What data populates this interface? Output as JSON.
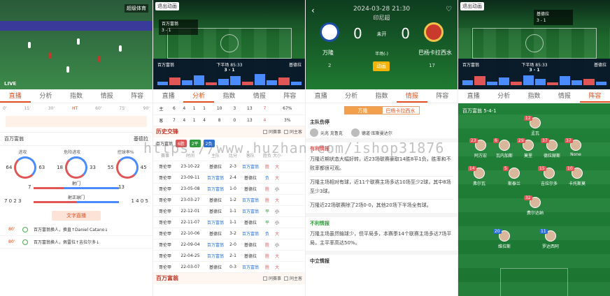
{
  "p1": {
    "video_channel": "超级体育",
    "live_label": "LIVE",
    "tabs": [
      "直播",
      "分析",
      "指数",
      "情报",
      "阵容"
    ],
    "timeline_marks": [
      "0'",
      "15'",
      "30'",
      "HT",
      "60'",
      "75'",
      "90'"
    ],
    "team_name": "百万富翁",
    "team_right": "基德拉",
    "stat_labels": [
      "进攻",
      "危险进攻",
      "控球率%"
    ],
    "stat_values": [
      "64",
      "63",
      "18",
      "33",
      "55",
      "45"
    ],
    "shots_label": "射门",
    "shots_left": "7",
    "shots_right": "13",
    "ontarget_label": "射正球门",
    "ontarget_left": "7 0 2 3",
    "ontarget_right": "1 4 0 5",
    "text_live_btn": "文字直播",
    "events": [
      {
        "minute": "80'",
        "text": "百万富翁换人，换直↑Daniel Catano↓"
      },
      {
        "minute": "80'",
        "text": "百万富翁换人，佩雷拉↑吉拉尔多↓"
      }
    ]
  },
  "p2": {
    "tag": "退出动画",
    "board_home": "百万富翁",
    "board_score": "3 - 1",
    "bar_left": "百万富翁",
    "bar_half": "下半场 85:33",
    "bar_score": "3 - 1",
    "bar_right": "基德拉",
    "tabs": [
      "直播",
      "分析",
      "指数",
      "情报",
      "阵容"
    ],
    "mini_rows": [
      [
        "主",
        "6",
        "4",
        "1",
        "1",
        "10",
        "3",
        "13",
        "7",
        "67%"
      ],
      [
        "客",
        "7",
        "4",
        "1",
        "4",
        "8",
        "0",
        "13",
        "4",
        "3%"
      ]
    ],
    "history_title": "历史交锋",
    "opt_same_home": "同赛事",
    "opt_same_side": "同主客",
    "record_label": "百万富翁",
    "record_pills": [
      "6胜",
      "2平",
      "2负"
    ],
    "col_headers": [
      "赛事",
      "时间",
      "主队",
      "比分",
      "客队",
      "胜负",
      "大小"
    ],
    "matches": [
      [
        "哥伦甲",
        "23-10-22",
        "基德拉",
        "2-3",
        "百万富翁",
        "胜",
        "大"
      ],
      [
        "哥伦甲",
        "23-09-11",
        "百万富翁",
        "2-4",
        "基德拉",
        "负",
        "大"
      ],
      [
        "哥伦甲",
        "23-05-08",
        "百万富翁",
        "1-0",
        "基德拉",
        "胜",
        "小"
      ],
      [
        "哥伦甲",
        "23-03-27",
        "基德拉",
        "1-2",
        "百万富翁",
        "胜",
        "大"
      ],
      [
        "哥伦甲",
        "22-12-01",
        "基德拉",
        "1-1",
        "百万富翁",
        "平",
        "小"
      ],
      [
        "哥伦甲",
        "22-11-07",
        "百万富翁",
        "1-1",
        "基德拉",
        "平",
        "小"
      ],
      [
        "哥伦甲",
        "22-10-06",
        "基德拉",
        "3-2",
        "百万富翁",
        "负",
        "大"
      ],
      [
        "哥伦甲",
        "22-09-04",
        "百万富翁",
        "2-0",
        "基德拉",
        "胜",
        "小"
      ],
      [
        "哥伦甲",
        "22-04-25",
        "百万富翁",
        "2-1",
        "基德拉",
        "胜",
        "大"
      ],
      [
        "哥伦甲",
        "22-03-07",
        "基德拉",
        "0-3",
        "百万富翁",
        "胜",
        "大"
      ]
    ],
    "recent_title": "百万富翁",
    "opt2_same_home": "同赛事",
    "opt2_same_side": "同主客"
  },
  "p3": {
    "datetime": "2024-03-28 21:30",
    "league": "印尼超",
    "home_score": "0",
    "status": "未开",
    "away_score": "0",
    "home_name": "万隆",
    "half": "半场(-)",
    "away_name": "巴杨卡拉西水",
    "corner_left": "2",
    "corner_right": "17",
    "anim_btn": "动画",
    "tabs": [
      "直播",
      "分析",
      "指数",
      "情报",
      "阵容"
    ],
    "team_toggle": [
      "万隆",
      "巴杨卡拉西水"
    ],
    "injury_title": "主队伤停",
    "injured": [
      "元兆 克鲁克",
      "德道·库斯曼达尔"
    ],
    "fav_title": "有利情报",
    "fav_paras": [
      "万隆近期状态大幅好转，近23场联赛豪取14胜8平1负，胜率和不败率都很可观。",
      "万隆主场相对有球，近11个联赛主场多达10场至少2球，其中8场至少3球。",
      "万隆近22场联赛除了2场0-0，其他20场下半场全有球。"
    ],
    "unfav_title": "不利情报",
    "unfav_paras": [
      "万隆主场虽然输球少，但平局多，本赛季14个联赛主场多达7场平局，主平率高达50%。"
    ],
    "neutral_title": "中立情报"
  },
  "p4": {
    "tag": "退出动画",
    "board_home": "基德拉",
    "board_score": "3 - 1",
    "bar_left": "百万富翁",
    "bar_half": "下半场 85:33",
    "bar_score": "3 - 1",
    "bar_right": "基德拉",
    "tabs": [
      "直播",
      "分析",
      "指数",
      "情报",
      "阵容"
    ],
    "formation": "百万富翁 5-4-1",
    "players": [
      {
        "num": "12",
        "name": "孟瓦"
      },
      {
        "num": "23",
        "name": "阿方宏"
      },
      {
        "num": "6",
        "name": "瓦内加斯"
      },
      {
        "num": "29",
        "name": "莫里"
      },
      {
        "num": "37",
        "name": "德拉赫斯"
      },
      {
        "num": "37",
        "name": "None"
      },
      {
        "num": "14",
        "name": "弗尔瓦"
      },
      {
        "num": "5",
        "name": "斯泰兰"
      },
      {
        "num": "15",
        "name": "吉拉尔多"
      },
      {
        "num": "10",
        "name": "卡托斯莫"
      },
      {
        "num": "32",
        "name": "费尔达纳"
      },
      {
        "num": "20",
        "name": "维拉斯"
      },
      {
        "num": "11",
        "name": "罗达西阿"
      }
    ]
  },
  "watermark": "https://www.huzhan.com/ishop31876"
}
